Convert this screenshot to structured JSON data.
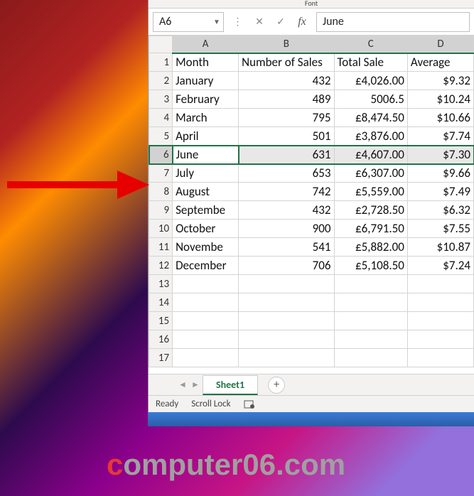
{
  "ribbon": {
    "group_label": "Font"
  },
  "name_box": {
    "value": "A6"
  },
  "formula_bar": {
    "value": "June"
  },
  "columns": [
    "A",
    "B",
    "C",
    "D"
  ],
  "selected_row": 6,
  "headers": {
    "A": "Month",
    "B": "Number of Sales",
    "C": "Total Sale",
    "D": "Average"
  },
  "rows": [
    {
      "n": 1,
      "A": "Month",
      "B": "Number of Sales",
      "C": "Total Sale",
      "D": "Average",
      "is_header": true
    },
    {
      "n": 2,
      "A": "January",
      "B": "432",
      "C": "£4,026.00",
      "D": "$9.32"
    },
    {
      "n": 3,
      "A": "February",
      "B": "489",
      "C": "5006.5",
      "D": "$10.24"
    },
    {
      "n": 4,
      "A": "March",
      "B": "795",
      "C": "£8,474.50",
      "D": "$10.66"
    },
    {
      "n": 5,
      "A": "April",
      "B": "501",
      "C": "£3,876.00",
      "D": "$7.74"
    },
    {
      "n": 6,
      "A": "June",
      "B": "631",
      "C": "£4,607.00",
      "D": "$7.30"
    },
    {
      "n": 7,
      "A": "July",
      "B": "653",
      "C": "£6,307.00",
      "D": "$9.66"
    },
    {
      "n": 8,
      "A": "August",
      "B": "742",
      "C": "£5,559.00",
      "D": "$7.49"
    },
    {
      "n": 9,
      "A": "Septembe",
      "B": "432",
      "C": "£2,728.50",
      "D": "$6.32"
    },
    {
      "n": 10,
      "A": "October",
      "B": "900",
      "C": "£6,791.50",
      "D": "$7.55"
    },
    {
      "n": 11,
      "A": "Novembe",
      "B": "541",
      "C": "£5,882.00",
      "D": "$10.87"
    },
    {
      "n": 12,
      "A": "December",
      "B": "706",
      "C": "£5,108.50",
      "D": "$7.24"
    },
    {
      "n": 13,
      "A": "",
      "B": "",
      "C": "",
      "D": ""
    },
    {
      "n": 14,
      "A": "",
      "B": "",
      "C": "",
      "D": ""
    },
    {
      "n": 15,
      "A": "",
      "B": "",
      "C": "",
      "D": ""
    },
    {
      "n": 16,
      "A": "",
      "B": "",
      "C": "",
      "D": ""
    },
    {
      "n": 17,
      "A": "",
      "B": "",
      "C": "",
      "D": ""
    }
  ],
  "sheet_tabs": {
    "active": "Sheet1"
  },
  "status_bar": {
    "ready": "Ready",
    "scroll_lock": "Scroll Lock"
  },
  "watermark": {
    "red": "c",
    "gray": "omputer06.com"
  },
  "chart_data": {
    "type": "table",
    "title": "Monthly Sales",
    "columns": [
      "Month",
      "Number of Sales",
      "Total Sale",
      "Average"
    ],
    "data": [
      [
        "January",
        432,
        "£4,026.00",
        "$9.32"
      ],
      [
        "February",
        489,
        "5006.5",
        "$10.24"
      ],
      [
        "March",
        795,
        "£8,474.50",
        "$10.66"
      ],
      [
        "April",
        501,
        "£3,876.00",
        "$7.74"
      ],
      [
        "June",
        631,
        "£4,607.00",
        "$7.30"
      ],
      [
        "July",
        653,
        "£6,307.00",
        "$9.66"
      ],
      [
        "August",
        742,
        "£5,559.00",
        "$7.49"
      ],
      [
        "September",
        432,
        "£2,728.50",
        "$6.32"
      ],
      [
        "October",
        900,
        "£6,791.50",
        "$7.55"
      ],
      [
        "November",
        541,
        "£5,882.00",
        "$10.87"
      ],
      [
        "December",
        706,
        "£5,108.50",
        "$7.24"
      ]
    ]
  }
}
